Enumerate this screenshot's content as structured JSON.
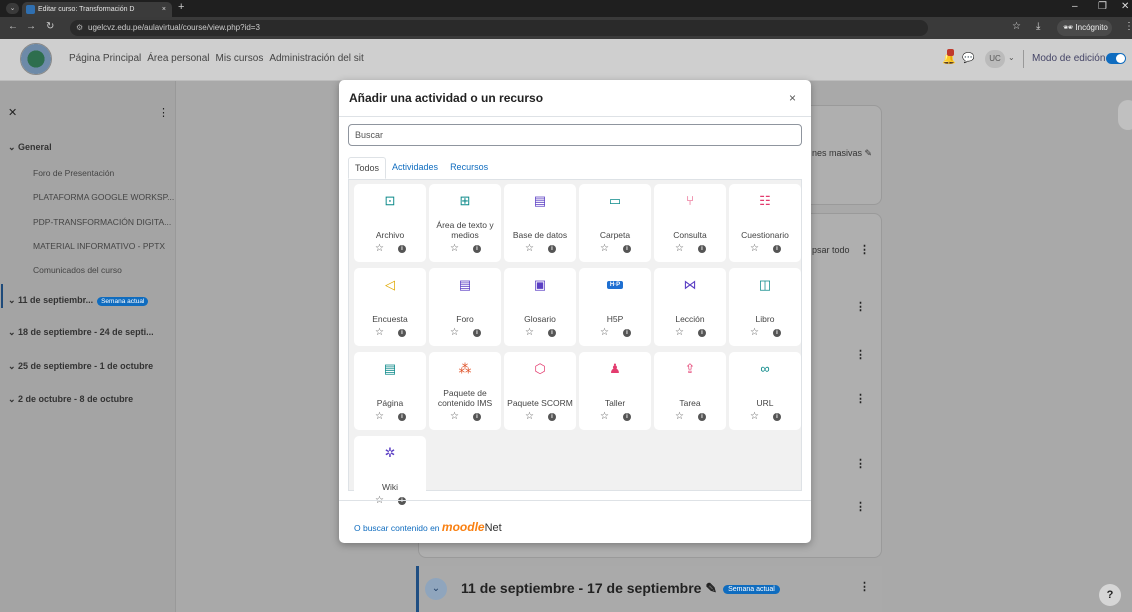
{
  "browser": {
    "tab_title": "Editar curso: Transformación D",
    "tab_close": "×",
    "new_tab": "+",
    "url": "ugelcvz.edu.pe/aulavirtual/course/view.php?id=3",
    "incognito_label": "Incógnito",
    "minimize": "–",
    "maximize": "❐",
    "close": "✕"
  },
  "header": {
    "nav": [
      "Página Principal",
      "Área personal",
      "Mis cursos",
      "Administración del sit"
    ],
    "avatar_initials": "UC",
    "edit_mode_label": "Modo de edición",
    "edit_mode_on": true,
    "accent_color": "#0f6cbf"
  },
  "drawer": {
    "general_label": "General",
    "activities": [
      "Foro de Presentación",
      "PLATAFORMA GOOGLE WORKSP...",
      "PDP-TRANSFORMACIÓN DIGITA...",
      "MATERIAL INFORMATIVO - PPTX",
      "Comunicados del curso"
    ],
    "sections": [
      "11 de septiembr...",
      "18 de septiembre - 24 de septi...",
      "25 de septiembre - 1 de octubre",
      "2 de octubre - 8 de octubre"
    ],
    "current_badge": "Semana actual"
  },
  "main": {
    "bulk_edit": "nes masivas",
    "collapse_all": "psar todo",
    "bottom_section_title": "11 de septiembre - 17 de septiembre",
    "bottom_section_badge": "Semana actual",
    "help": "?"
  },
  "modal": {
    "title": "Añadir una actividad o un recurso",
    "close": "×",
    "search_placeholder": "Buscar",
    "tabs": [
      "Todos",
      "Actividades",
      "Recursos"
    ],
    "active_tab": "Todos",
    "modules": [
      {
        "label": "Archivo",
        "icon": "file-icon",
        "color": "#0d8a8a"
      },
      {
        "label": "Área de texto y medios",
        "icon": "text-media-icon",
        "color": "#0d8a8a"
      },
      {
        "label": "Base de datos",
        "icon": "database-icon",
        "color": "#5b3fc4"
      },
      {
        "label": "Carpeta",
        "icon": "folder-icon",
        "color": "#0d8a8a"
      },
      {
        "label": "Consulta",
        "icon": "choice-icon",
        "color": "#e33b6e"
      },
      {
        "label": "Cuestionario",
        "icon": "quiz-icon",
        "color": "#e33b6e"
      },
      {
        "label": "Encuesta",
        "icon": "feedback-icon",
        "color": "#e0a800"
      },
      {
        "label": "Foro",
        "icon": "forum-icon",
        "color": "#5b3fc4"
      },
      {
        "label": "Glosario",
        "icon": "glossary-icon",
        "color": "#5b3fc4"
      },
      {
        "label": "H5P",
        "icon": "h5p-icon",
        "color": "#1f6fd1"
      },
      {
        "label": "Lección",
        "icon": "lesson-icon",
        "color": "#5b3fc4"
      },
      {
        "label": "Libro",
        "icon": "book-icon",
        "color": "#0d8a8a"
      },
      {
        "label": "Página",
        "icon": "page-icon",
        "color": "#0d8a8a"
      },
      {
        "label": "Paquete de contenido IMS",
        "icon": "ims-icon",
        "color": "#e0542b"
      },
      {
        "label": "Paquete SCORM",
        "icon": "scorm-icon",
        "color": "#e33b6e"
      },
      {
        "label": "Taller",
        "icon": "workshop-icon",
        "color": "#e33b6e"
      },
      {
        "label": "Tarea",
        "icon": "assignment-icon",
        "color": "#e33b6e"
      },
      {
        "label": "URL",
        "icon": "url-icon",
        "color": "#0d8a8a"
      },
      {
        "label": "Wiki",
        "icon": "wiki-icon",
        "color": "#5b3fc4"
      }
    ],
    "footer_prefix": "O buscar contenido en",
    "footer_brand_a": "moodle",
    "footer_brand_b": "Net"
  }
}
